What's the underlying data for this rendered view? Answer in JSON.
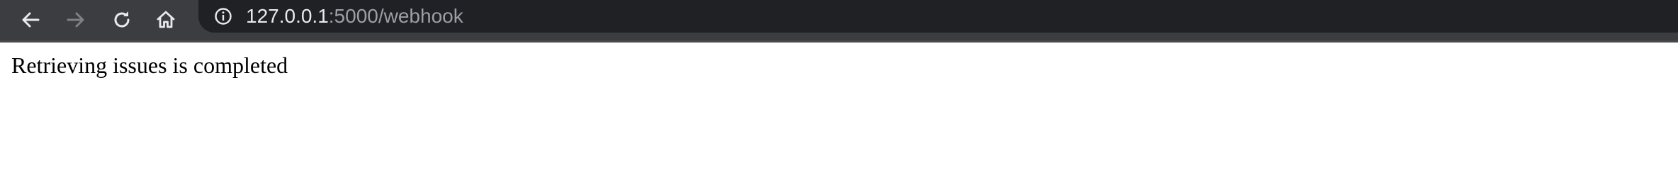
{
  "browser": {
    "url_host": "127.0.0.1",
    "url_rest": ":5000/webhook",
    "buttons": {
      "back": "arrow-left-icon",
      "forward": "arrow-right-icon",
      "reload": "reload-icon",
      "home": "home-icon"
    },
    "site_info_icon": "info-circle-icon",
    "colors": {
      "toolbar": "#3b3d40",
      "omnibox": "#202124",
      "icon_active": "#e8eaed",
      "icon_disabled": "#7f8185",
      "url_secondary": "#9aa0a6"
    }
  },
  "page": {
    "message": "Retrieving issues is completed"
  }
}
